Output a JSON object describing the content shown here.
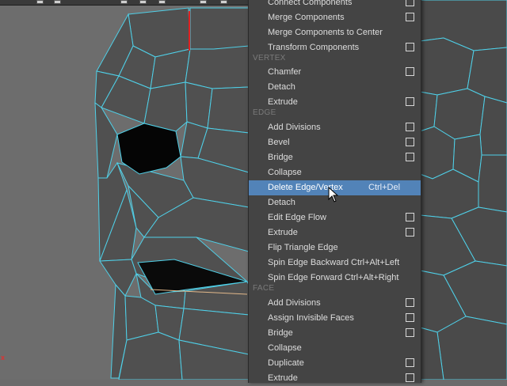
{
  "sections": {
    "vertex": "VERTEX",
    "edge": "EDGE",
    "face": "FACE"
  },
  "items": [
    {
      "label": "Connect Components",
      "checkbox": true
    },
    {
      "label": "Merge Components",
      "checkbox": true
    },
    {
      "label": "Merge Components to Center",
      "checkbox": false
    },
    {
      "label": "Transform Components",
      "checkbox": true
    },
    {
      "label": "Chamfer",
      "checkbox": true
    },
    {
      "label": "Detach",
      "checkbox": false
    },
    {
      "label": "Extrude",
      "checkbox": true
    },
    {
      "label": "Add Divisions",
      "checkbox": true
    },
    {
      "label": "Bevel",
      "checkbox": true
    },
    {
      "label": "Bridge",
      "checkbox": true
    },
    {
      "label": "Collapse",
      "checkbox": false
    },
    {
      "label": "Delete Edge/Vertex",
      "shortcut": "Ctrl+Del",
      "checkbox": false,
      "highlighted": true
    },
    {
      "label": "Detach",
      "checkbox": false
    },
    {
      "label": "Edit Edge Flow",
      "checkbox": true
    },
    {
      "label": "Extrude",
      "checkbox": true
    },
    {
      "label": "Flip Triangle Edge",
      "checkbox": false
    },
    {
      "label": "Spin Edge Backward",
      "shortcut": "Ctrl+Alt+Left",
      "checkbox": false
    },
    {
      "label": "Spin Edge Forward",
      "shortcut": "Ctrl+Alt+Right",
      "checkbox": false
    },
    {
      "label": "Add Divisions",
      "checkbox": true
    },
    {
      "label": "Assign Invisible Faces",
      "checkbox": true
    },
    {
      "label": "Bridge",
      "checkbox": true
    },
    {
      "label": "Collapse",
      "checkbox": false
    },
    {
      "label": "Duplicate",
      "checkbox": true
    },
    {
      "label": "Extrude",
      "checkbox": true
    }
  ],
  "viewport": {
    "axis_label": "x",
    "wire_color": "#4fd0e8",
    "axis_color": "#e02020"
  },
  "colors": {
    "menu_bg": "#444444",
    "highlight": "#5283b8",
    "section_text": "#7a7a7a"
  }
}
